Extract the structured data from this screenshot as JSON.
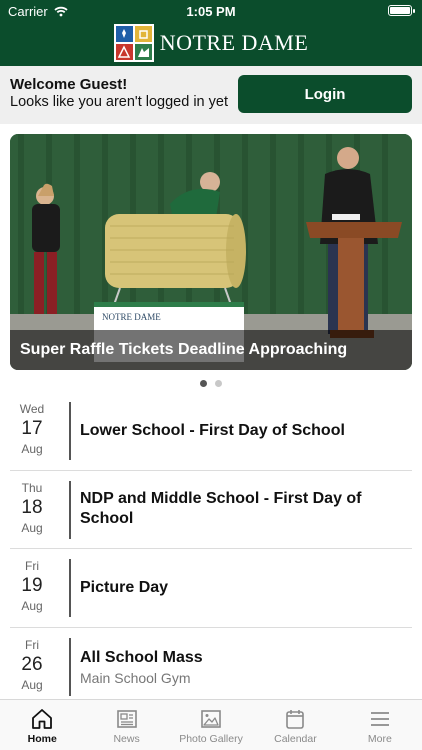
{
  "status_bar": {
    "carrier": "Carrier",
    "time": "1:05 PM"
  },
  "header": {
    "brand_name": "NOTRE DAME"
  },
  "welcome": {
    "title": "Welcome Guest!",
    "subtitle": "Looks like you aren't logged in yet",
    "login_label": "Login"
  },
  "carousel": {
    "caption": "Super Raffle Tickets Deadline Approaching",
    "sign_text": "NOTRE DAME",
    "slide_count": 2,
    "active_index": 0
  },
  "events": [
    {
      "dow": "Wed",
      "day": "17",
      "month": "Aug",
      "title": "Lower School - First Day of School",
      "subtitle": ""
    },
    {
      "dow": "Thu",
      "day": "18",
      "month": "Aug",
      "title": "NDP and Middle School - First Day of School",
      "subtitle": ""
    },
    {
      "dow": "Fri",
      "day": "19",
      "month": "Aug",
      "title": "Picture Day",
      "subtitle": ""
    },
    {
      "dow": "Fri",
      "day": "26",
      "month": "Aug",
      "title": "All School Mass",
      "subtitle": "Main School Gym"
    }
  ],
  "tabbar": {
    "items": [
      {
        "label": "Home",
        "icon": "home-icon",
        "active": true
      },
      {
        "label": "News",
        "icon": "news-icon",
        "active": false
      },
      {
        "label": "Photo Gallery",
        "icon": "photo-gallery-icon",
        "active": false
      },
      {
        "label": "Calendar",
        "icon": "calendar-icon",
        "active": false
      },
      {
        "label": "More",
        "icon": "menu-icon",
        "active": false
      }
    ]
  },
  "colors": {
    "brand_green": "#0b4d2c",
    "banner_gray": "#efefef"
  }
}
